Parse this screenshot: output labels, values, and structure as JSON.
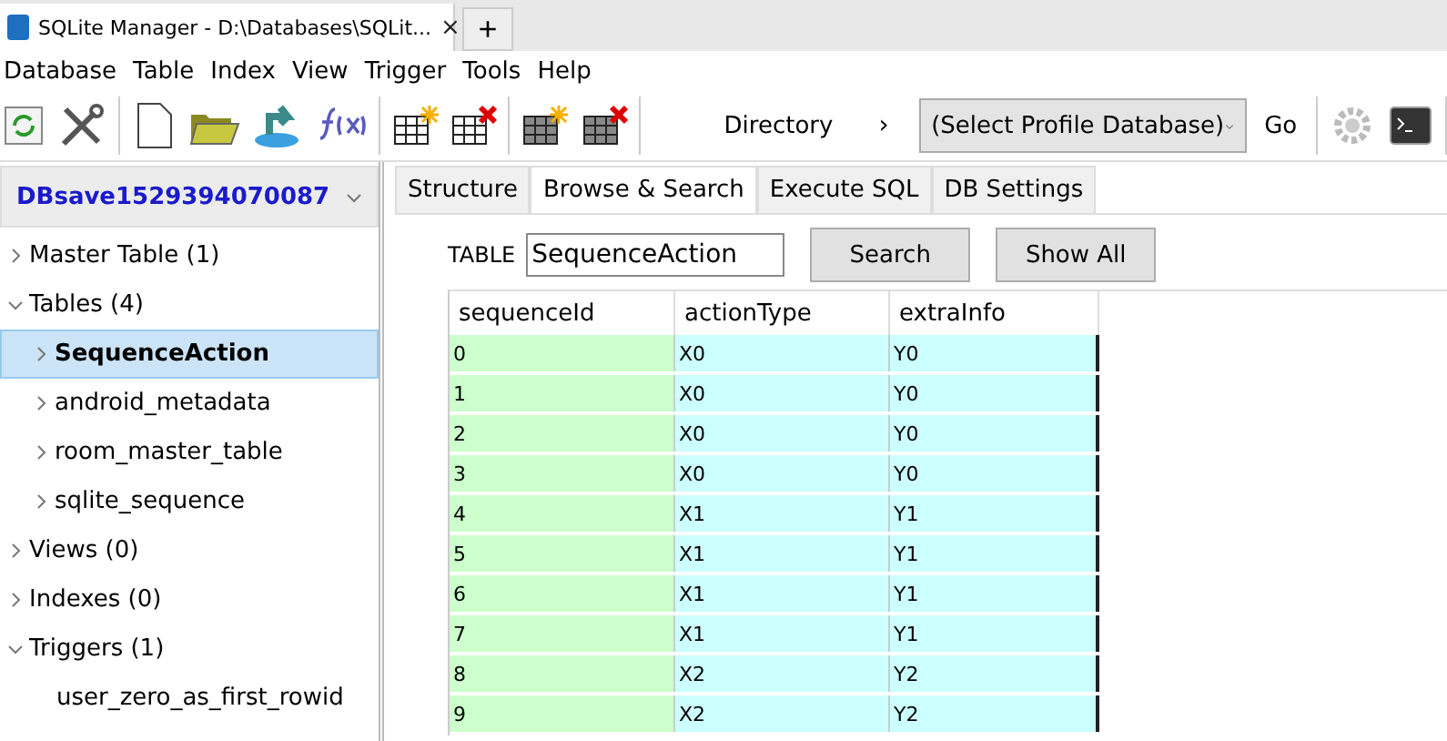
{
  "window": {
    "title": "SQLite Manager - D:\\Databases\\SQLit...",
    "close": "×",
    "new_tab": "+"
  },
  "menu": [
    "Database",
    "Table",
    "Index",
    "View",
    "Trigger",
    "Tools",
    "Help"
  ],
  "toolbar": {
    "directory": "Directory",
    "arrow": "›",
    "profile": "(Select Profile Database)",
    "go": "Go"
  },
  "database": "DBsave1529394070087",
  "tree": [
    {
      "label": "Master Table (1)",
      "expanded": false,
      "selected": false
    },
    {
      "label": "Tables (4)",
      "expanded": true,
      "selected": false,
      "children": [
        {
          "label": "SequenceAction",
          "selected": true,
          "kind": "table"
        },
        {
          "label": "android_metadata",
          "selected": false,
          "kind": "table"
        },
        {
          "label": "room_master_table",
          "selected": false,
          "kind": "table"
        },
        {
          "label": "sqlite_sequence",
          "selected": false,
          "kind": "table"
        }
      ]
    },
    {
      "label": "Views (0)",
      "expanded": false,
      "selected": false
    },
    {
      "label": "Indexes (0)",
      "expanded": false,
      "selected": false
    },
    {
      "label": "Triggers (1)",
      "expanded": true,
      "selected": false,
      "children": [
        {
          "label": "user_zero_as_first_rowid",
          "selected": false,
          "kind": "trigger"
        }
      ]
    }
  ],
  "tabs": [
    {
      "label": "Structure",
      "selected": false
    },
    {
      "label": "Browse & Search",
      "selected": true
    },
    {
      "label": "Execute SQL",
      "selected": false
    },
    {
      "label": "DB Settings",
      "selected": false
    }
  ],
  "browse": {
    "table_label": "TABLE",
    "table_value": "SequenceAction",
    "search": "Search",
    "show_all": "Show All"
  },
  "table": {
    "columns": [
      "sequenceId",
      "actionType",
      "extraInfo"
    ],
    "rows": [
      [
        "0",
        "X0",
        "Y0"
      ],
      [
        "1",
        "X0",
        "Y0"
      ],
      [
        "2",
        "X0",
        "Y0"
      ],
      [
        "3",
        "X0",
        "Y0"
      ],
      [
        "4",
        "X1",
        "Y1"
      ],
      [
        "5",
        "X1",
        "Y1"
      ],
      [
        "6",
        "X1",
        "Y1"
      ],
      [
        "7",
        "X1",
        "Y1"
      ],
      [
        "8",
        "X2",
        "Y2"
      ],
      [
        "9",
        "X2",
        "Y2"
      ]
    ]
  }
}
